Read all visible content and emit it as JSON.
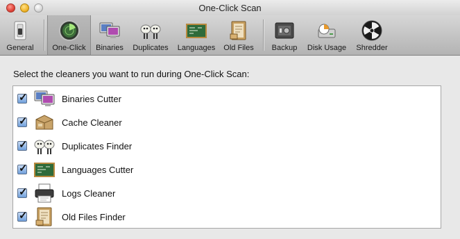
{
  "window": {
    "title": "One-Click Scan"
  },
  "toolbar": {
    "items": [
      {
        "label": "General",
        "icon": "general-switch-icon",
        "selected": false
      },
      {
        "label": "One-Click",
        "icon": "one-click-radar-icon",
        "selected": true
      },
      {
        "label": "Binaries",
        "icon": "binaries-computers-icon",
        "selected": false
      },
      {
        "label": "Duplicates",
        "icon": "duplicates-sheep-icon",
        "selected": false
      },
      {
        "label": "Languages",
        "icon": "languages-chalkboard-icon",
        "selected": false
      },
      {
        "label": "Old Files",
        "icon": "old-files-folder-icon",
        "selected": false
      },
      {
        "label": "Backup",
        "icon": "backup-safe-icon",
        "selected": false
      },
      {
        "label": "Disk Usage",
        "icon": "disk-usage-drive-icon",
        "selected": false
      },
      {
        "label": "Shredder",
        "icon": "shredder-radiation-icon",
        "selected": false
      }
    ]
  },
  "content": {
    "instruction": "Select the cleaners you want to run during One-Click Scan:",
    "cleaners": [
      {
        "label": "Binaries Cutter",
        "checked": true,
        "icon": "binaries-computers-icon"
      },
      {
        "label": "Cache Cleaner",
        "checked": true,
        "icon": "cache-box-icon"
      },
      {
        "label": "Duplicates Finder",
        "checked": true,
        "icon": "duplicates-sheep-icon"
      },
      {
        "label": "Languages Cutter",
        "checked": true,
        "icon": "languages-chalkboard-icon"
      },
      {
        "label": "Logs Cleaner",
        "checked": true,
        "icon": "logs-printer-icon"
      },
      {
        "label": "Old Files Finder",
        "checked": true,
        "icon": "old-files-folder-icon"
      }
    ]
  },
  "colors": {
    "checkbox_fill": "#6f9fdb",
    "selected_tab": "#a4a4a4",
    "list_background": "#ffffff"
  }
}
